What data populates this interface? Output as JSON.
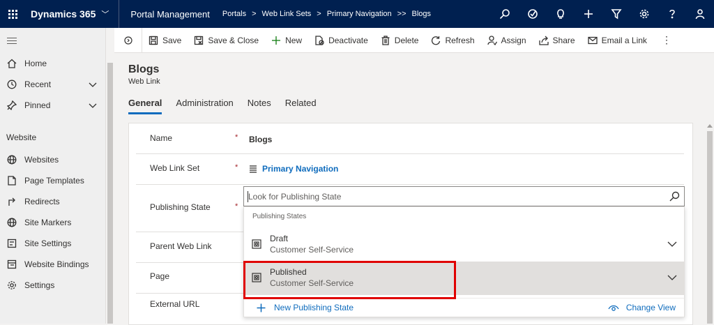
{
  "topbar": {
    "app_name": "Dynamics 365",
    "area_name": "Portal Management",
    "breadcrumbs": [
      "Portals",
      "Web Link Sets",
      "Primary Navigation",
      "Blogs"
    ],
    "icons": [
      "search-icon",
      "assistant-icon",
      "lightbulb-icon",
      "plus-icon",
      "filter-icon",
      "gear-icon",
      "help-icon",
      "user-icon"
    ]
  },
  "leftnav": {
    "top_items": [
      {
        "label": "Home",
        "icon": "home-icon"
      },
      {
        "label": "Recent",
        "icon": "clock-icon"
      },
      {
        "label": "Pinned",
        "icon": "pin-icon"
      }
    ],
    "group_label": "Website",
    "group_items": [
      {
        "label": "Websites",
        "icon": "globe-icon"
      },
      {
        "label": "Page Templates",
        "icon": "page-icon"
      },
      {
        "label": "Redirects",
        "icon": "redirect-icon"
      },
      {
        "label": "Site Markers",
        "icon": "globe-icon"
      },
      {
        "label": "Site Settings",
        "icon": "settings-list-icon"
      },
      {
        "label": "Website Bindings",
        "icon": "binding-icon"
      },
      {
        "label": "Settings",
        "icon": "gear-icon"
      }
    ]
  },
  "commandbar": {
    "save": "Save",
    "save_close": "Save & Close",
    "new": "New",
    "deactivate": "Deactivate",
    "delete": "Delete",
    "refresh": "Refresh",
    "assign": "Assign",
    "share": "Share",
    "email_link": "Email a Link",
    "more": "⋮"
  },
  "record": {
    "title": "Blogs",
    "type": "Web Link"
  },
  "tabs": [
    "General",
    "Administration",
    "Notes",
    "Related"
  ],
  "form": {
    "required_marker": "*",
    "fields": {
      "name": {
        "label": "Name",
        "value": "Blogs"
      },
      "web_link_set": {
        "label": "Web Link Set",
        "value": "Primary Navigation"
      },
      "publishing_state": {
        "label": "Publishing State"
      },
      "parent_web_link": {
        "label": "Parent Web Link"
      },
      "page": {
        "label": "Page"
      },
      "external_url": {
        "label": "External URL"
      }
    }
  },
  "lookup": {
    "placeholder": "Look for Publishing State",
    "section_header": "Publishing States",
    "results": [
      {
        "name": "Draft",
        "secondary": "Customer Self-Service"
      },
      {
        "name": "Published",
        "secondary": "Customer Self-Service"
      }
    ],
    "new_label": "New Publishing State",
    "change_view_label": "Change View"
  },
  "colors": {
    "topbar_bg": "#002050",
    "accent_blue": "#0f6cbd",
    "highlight_red": "#e00000",
    "required_red": "#a4262c"
  }
}
